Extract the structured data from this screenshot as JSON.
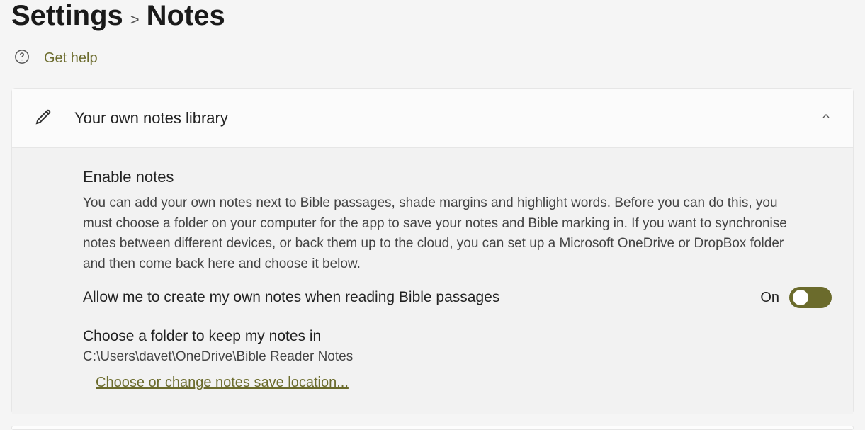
{
  "breadcrumb": {
    "root": "Settings",
    "separator": ">",
    "current": "Notes"
  },
  "help": {
    "label": "Get help"
  },
  "card": {
    "title": "Your own notes library",
    "enable": {
      "title": "Enable notes",
      "description": "You can add your own notes next to Bible passages, shade margins and highlight words. Before you can do this, you must choose a folder on your computer for the app to save your notes and Bible marking in. If you want to synchronise notes between different devices, or back them up to the cloud, you can set up a Microsoft OneDrive or DropBox folder and then come back here and choose it below."
    },
    "toggle": {
      "label": "Allow me to create my own notes when reading Bible passages",
      "stateText": "On",
      "state": true
    },
    "folder": {
      "title": "Choose a folder to keep my notes in",
      "path": "C:\\Users\\davet\\OneDrive\\Bible Reader Notes",
      "linkLabel": "Choose or change notes save location..."
    }
  }
}
